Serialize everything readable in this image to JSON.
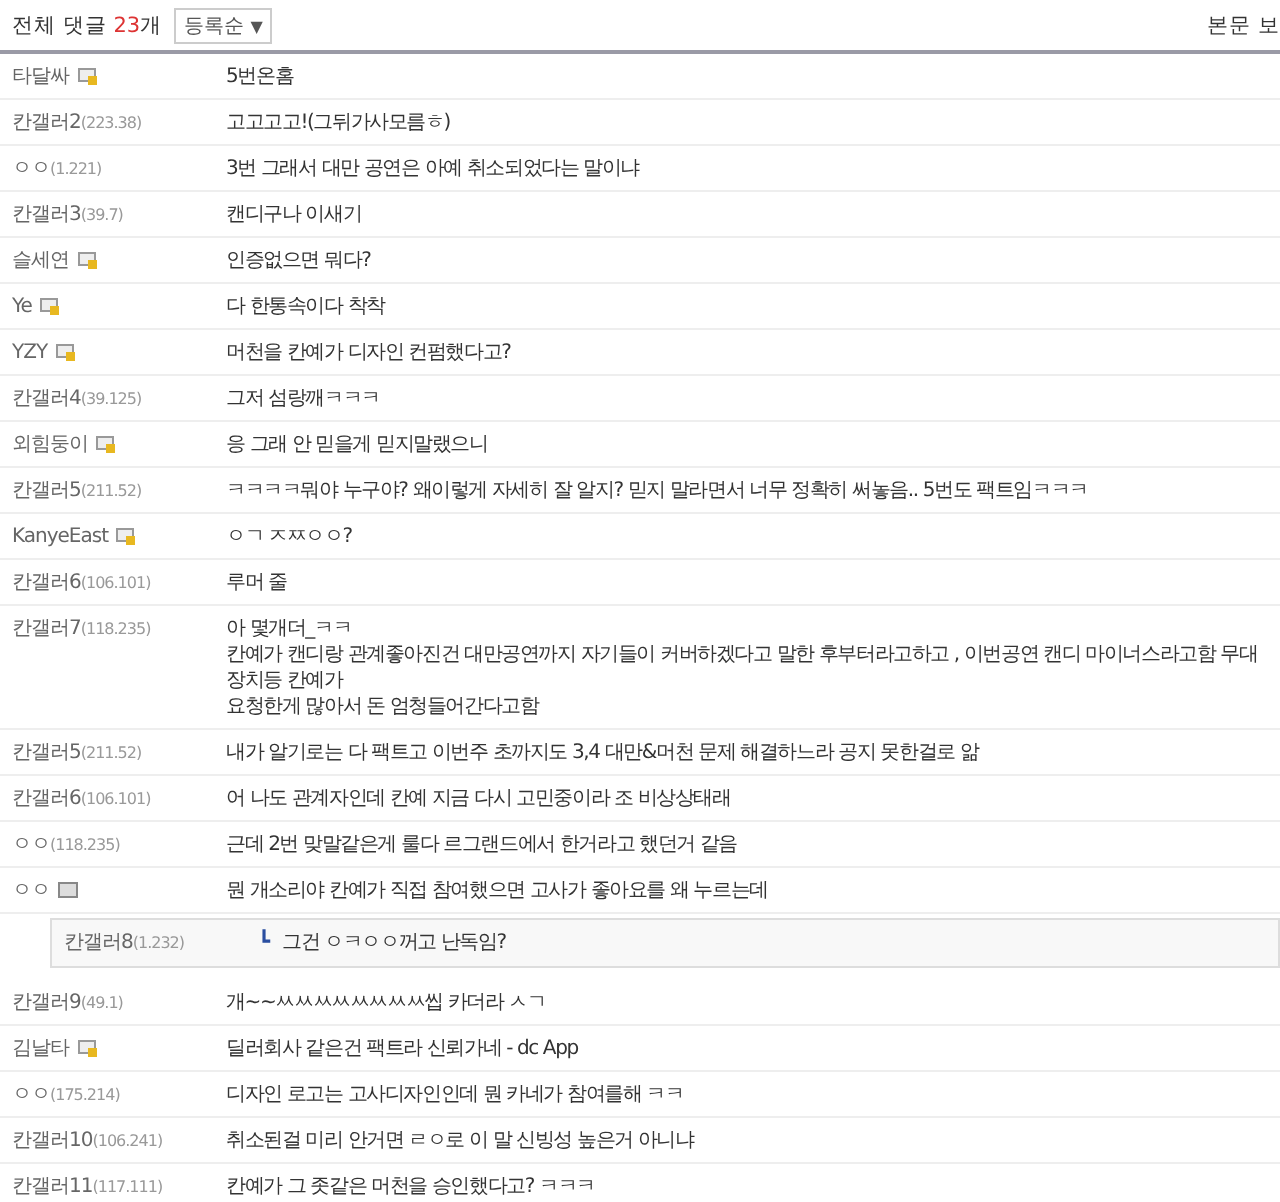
{
  "header": {
    "label": "전체 댓글",
    "count": "23",
    "count_suffix": "개",
    "sort": {
      "value": "등록순",
      "caret": "▼"
    },
    "view_link": "본문 보"
  },
  "comments": [
    {
      "nick": "타달싸",
      "kind": "fixed",
      "reply": false,
      "lines": [
        "5번온홈"
      ]
    },
    {
      "nick": "칸갤러2",
      "ip": "(223.38)",
      "reply": false,
      "lines": [
        "고고고고!(그뒤가사모름ㅎ)"
      ]
    },
    {
      "nick": "ㅇㅇ",
      "ip": "(1.221)",
      "reply": false,
      "lines": [
        "3번 그래서 대만 공연은 아예 취소되었다는 말이냐"
      ]
    },
    {
      "nick": "칸갤러3",
      "ip": "(39.7)",
      "reply": false,
      "lines": [
        "캔디구나 이새기"
      ]
    },
    {
      "nick": "슬세연",
      "kind": "fixed",
      "reply": false,
      "lines": [
        "인증없으면 뭐다?"
      ]
    },
    {
      "nick": "Ye",
      "kind": "fixed",
      "reply": false,
      "lines": [
        "다 한통속이다 착착"
      ]
    },
    {
      "nick": "YZY",
      "kind": "fixed",
      "reply": false,
      "lines": [
        "머천을 칸예가 디자인 컨펌했다고?"
      ]
    },
    {
      "nick": "칸갤러4",
      "ip": "(39.125)",
      "reply": false,
      "lines": [
        "그저 섬랑깨ㅋㅋㅋ"
      ]
    },
    {
      "nick": "외힘둥이",
      "kind": "fixed",
      "reply": false,
      "lines": [
        "응 그래 안 믿을게 믿지말랬으니"
      ]
    },
    {
      "nick": "칸갤러5",
      "ip": "(211.52)",
      "reply": false,
      "lines": [
        "ㅋㅋㅋㅋ뭐야 누구야? 왜이렇게 자세히 잘 알지? 믿지 말라면서 너무 정확히 써놓음.. 5번도 팩트임ㅋㅋㅋ"
      ]
    },
    {
      "nick": "KanyeEast",
      "kind": "fixed",
      "reply": false,
      "lines": [
        "ㅇㄱ ㅈㅉㅇㅇ?"
      ]
    },
    {
      "nick": "칸갤러6",
      "ip": "(106.101)",
      "reply": false,
      "lines": [
        "루머 줄"
      ]
    },
    {
      "nick": "칸갤러7",
      "ip": "(118.235)",
      "reply": false,
      "lines": [
        "아 몇개더_ㅋㅋ",
        "칸예가 캔디랑 관계좋아진건 대만공연까지 자기들이 커버하겠다고 말한 후부터라고하고 , 이번공연 캔디 마이너스라고함 무대장치등 칸예가",
        "요청한게 많아서 돈 엄청들어간다고함"
      ]
    },
    {
      "nick": "칸갤러5",
      "ip": "(211.52)",
      "reply": false,
      "lines": [
        "내가 알기로는 다 팩트고 이번주 초까지도 3,4 대만&머천 문제 해결하느라 공지 못한걸로 앎"
      ]
    },
    {
      "nick": "칸갤러6",
      "ip": "(106.101)",
      "reply": false,
      "lines": [
        "어 나도 관계자인데 칸예 지금 다시 고민중이라 조 비상상태래"
      ]
    },
    {
      "nick": "ㅇㅇ",
      "ip": "(118.235)",
      "reply": false,
      "lines": [
        "근데 2번 맞말같은게 룰다 르그랜드에서 한거라고 했던거 같음"
      ]
    },
    {
      "nick": "ㅇㅇ",
      "kind": "half",
      "reply": false,
      "lines": [
        "뭔 개소리야 칸예가 직접 참여했으면 고사가 좋아요를 왜 누르는데"
      ]
    },
    {
      "nick": "칸갤러8",
      "ip": "(1.232)",
      "reply": true,
      "mark": "┗",
      "lines": [
        "그건 ㅇㅋㅇㅇ꺼고 난독임?"
      ]
    },
    {
      "nick": "칸갤러9",
      "ip": "(49.1)",
      "reply": false,
      "lines": [
        "개~~ㅆㅆㅆㅆㅆㅆㅆㅆ씹 카더라 ㅅㄱ"
      ]
    },
    {
      "nick": "김날타",
      "kind": "fixed",
      "reply": false,
      "lines": [
        "딜러회사 같은건 팩트라 신뢰가네 - dc App"
      ]
    },
    {
      "nick": "ㅇㅇ",
      "ip": "(175.214)",
      "reply": false,
      "lines": [
        "디자인 로고는 고사디자인인데 뭔 카네가 참여를해 ㅋㅋ"
      ]
    },
    {
      "nick": "칸갤러10",
      "ip": "(106.241)",
      "reply": false,
      "lines": [
        "취소된걸 미리 안거면 ㄹㅇ로 이 말 신빙성 높은거 아니냐"
      ]
    },
    {
      "nick": "칸갤러11",
      "ip": "(117.111)",
      "reply": false,
      "lines": [
        "칸예가 그 좃같은 머천을 승인했다고? ㅋㅋㅋ"
      ]
    }
  ]
}
